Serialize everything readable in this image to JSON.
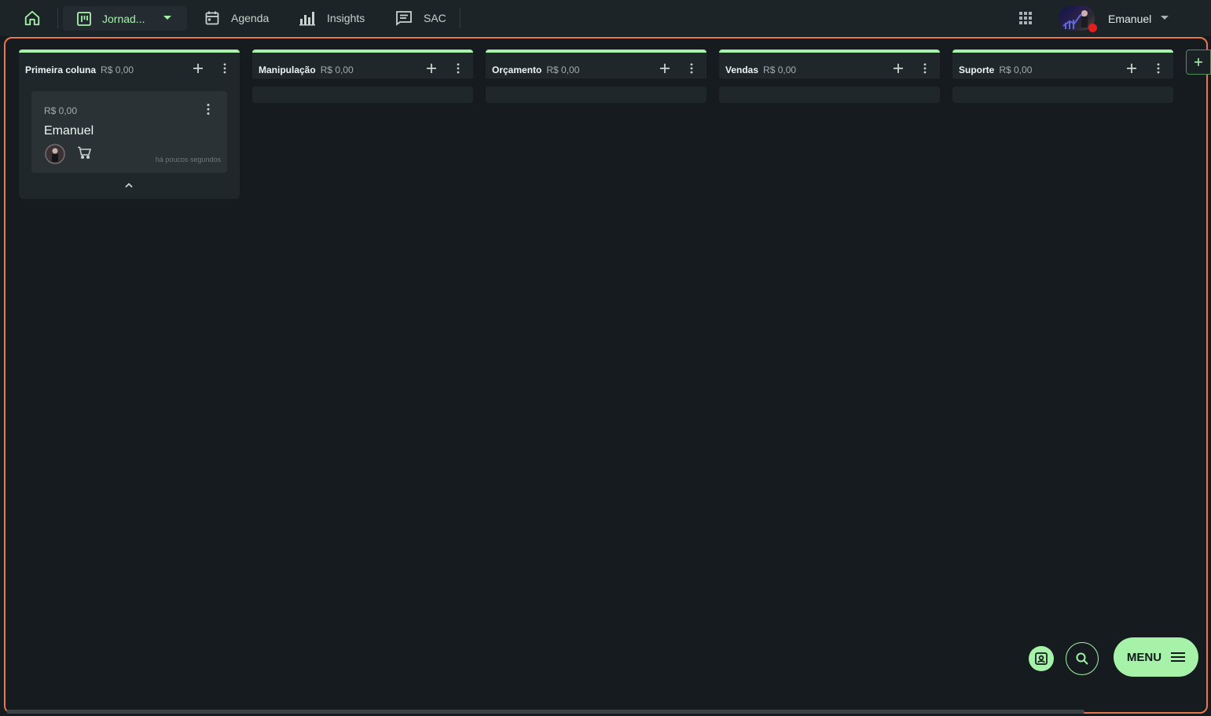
{
  "topbar": {
    "board_label": "Jornad...",
    "nav": [
      {
        "label": "Agenda",
        "icon": "calendar-icon"
      },
      {
        "label": "Insights",
        "icon": "bar-chart-icon"
      },
      {
        "label": "SAC",
        "icon": "chat-icon"
      }
    ],
    "user_name": "Emanuel"
  },
  "columns": [
    {
      "title": "Primeira coluna",
      "value": "R$ 0,00"
    },
    {
      "title": "Manipulação",
      "value": "R$ 0,00"
    },
    {
      "title": "Orçamento",
      "value": "R$ 0,00"
    },
    {
      "title": "Vendas",
      "value": "R$ 0,00"
    },
    {
      "title": "Suporte",
      "value": "R$ 0,00"
    }
  ],
  "card": {
    "value": "R$ 0,00",
    "title": "Emanuel",
    "time": "há poucos segundos"
  },
  "fab": {
    "menu_label": "MENU"
  },
  "colors": {
    "accent": "#a6f2a8",
    "frame": "#e8784c",
    "background": "#151b1f"
  }
}
